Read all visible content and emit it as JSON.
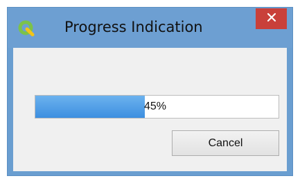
{
  "window": {
    "title": "Progress Indication",
    "app_icon": "qgis-logo-icon",
    "close_icon": "close-icon",
    "close_color": "#c9403a",
    "accent_color": "#6d9fd2"
  },
  "progress": {
    "value_percent": 45,
    "label": "45%",
    "fill_color": "#3d8fe0"
  },
  "buttons": {
    "cancel_label": "Cancel"
  }
}
